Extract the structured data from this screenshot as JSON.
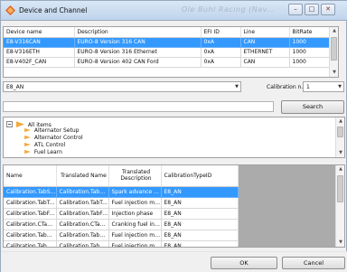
{
  "window": {
    "title": "Device and Channel",
    "ghost_title": "Ole Buhl Racing (Nav...",
    "minimize": "–",
    "maximize": "□",
    "close": "✕"
  },
  "devices": {
    "columns": [
      "Device name",
      "Description",
      "EFI ID",
      "Line",
      "BitRate"
    ],
    "rows": [
      {
        "name": "E8-V316CAN",
        "description": "EURO-8 Version 316 CAN",
        "efi_id": "0xA",
        "line": "CAN",
        "bitrate": "1000",
        "selected": true
      },
      {
        "name": "E8-V316ETH",
        "description": "EURO-8 Version 316 Ethernet",
        "efi_id": "0xA",
        "line": "ETHERNET",
        "bitrate": "1000",
        "selected": false
      },
      {
        "name": "E8-V402F_CAN",
        "description": "EURO-8 Version 402 CAN Ford",
        "efi_id": "0xA",
        "line": "CAN",
        "bitrate": "1000",
        "selected": false
      }
    ]
  },
  "channel_select": {
    "value": "E8_AN"
  },
  "calibration": {
    "label": "Calibration n.",
    "value": "1"
  },
  "search": {
    "placeholder": "",
    "value": "",
    "button": "Search"
  },
  "tree": {
    "root": "All items",
    "children": [
      "Alternator Setup",
      "Alternator Control",
      "ATL Control",
      "Fuel Learn"
    ]
  },
  "calibrations": {
    "columns": [
      "Name",
      "Translated Name",
      "Translated Description",
      "CalibrationTypeID"
    ],
    "rows": [
      {
        "name": "Calibration.TabS...",
        "translated_name": "Calibration.TabS...",
        "translated_description": "Spark advance ...",
        "type_id": "E8_AN",
        "selected": true
      },
      {
        "name": "Calibration.TabT...",
        "translated_name": "Calibration.TabT...",
        "translated_description": "Fuel injection map",
        "type_id": "E8_AN",
        "selected": false
      },
      {
        "name": "Calibration.TabFa...",
        "translated_name": "Calibration.TabFa...",
        "translated_description": "Injection phase",
        "type_id": "E8_AN",
        "selected": false
      },
      {
        "name": "Calibration.CTab...",
        "translated_name": "Calibration.CTab...",
        "translated_description": "Cranking fuel inje...",
        "type_id": "E8_AN",
        "selected": false
      },
      {
        "name": "Calibration.TabKl...",
        "translated_name": "Calibration.TabKl...",
        "translated_description": "Fuel injection mul...",
        "type_id": "E8_AN",
        "selected": false
      },
      {
        "name": "Calibration.TabKl...",
        "translated_name": "Calibration.TabKl...",
        "translated_description": "Fuel injection mul...",
        "type_id": "E8_AN",
        "selected": false
      }
    ]
  },
  "buttons": {
    "ok": "OK",
    "cancel": "Cancel"
  },
  "colors": {
    "selection": "#3399ff",
    "folder": "#f3a93b",
    "grid_empty": "#ababab"
  },
  "icons": {
    "app": "device-icon",
    "folder": "folder-icon",
    "tree_expand": "tree-collapse-icon"
  }
}
